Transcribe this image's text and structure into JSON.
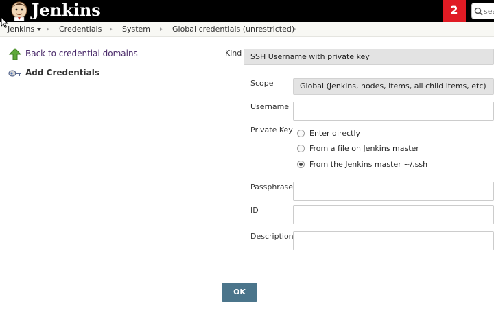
{
  "header": {
    "brand": "Jenkins",
    "notification_count": "2",
    "search_placeholder": "search"
  },
  "breadcrumb": {
    "items": [
      "Jenkins",
      "Credentials",
      "System",
      "Global credentials (unrestricted)"
    ]
  },
  "side_panel": {
    "back_link": "Back to credential domains",
    "add_credentials": "Add Credentials"
  },
  "form": {
    "kind_label": "Kind",
    "kind_value": "SSH Username with private key",
    "scope_label": "Scope",
    "scope_value": "Global (Jenkins, nodes, items, all child items, etc)",
    "username_label": "Username",
    "username_value": "",
    "private_key_label": "Private Key",
    "private_key_options": [
      "Enter directly",
      "From a file on Jenkins master",
      "From the Jenkins master ~/.ssh"
    ],
    "private_key_selected": "From the Jenkins master ~/.ssh",
    "passphrase_label": "Passphrase",
    "passphrase_value": "",
    "id_label": "ID",
    "id_value": "",
    "description_label": "Description",
    "description_value": "",
    "ok_label": "OK"
  },
  "colors": {
    "header_bg": "#000000",
    "notification_bg": "#e01b24",
    "ok_button_bg": "#4b758b",
    "link_color": "#4a2a6a"
  },
  "icons": [
    "jenkins-logo",
    "search-icon",
    "up-arrow-icon",
    "key-icon",
    "dropdown-caret-icon"
  ]
}
